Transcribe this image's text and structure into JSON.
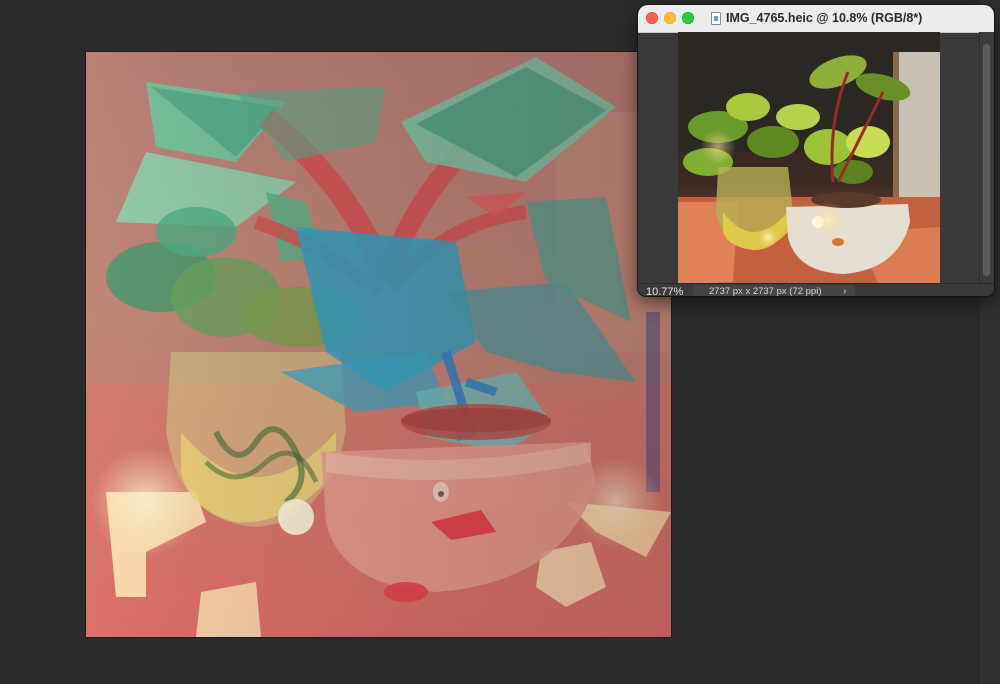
{
  "document": {
    "title": "IMG_4765.heic @ 10.8% (RGB/8*)",
    "zoom": "10.77%",
    "size_info": "2737 px x 2737 px (72 ppi)",
    "status_arrow": "›"
  },
  "icons": {
    "close": "close-traffic-light",
    "minimize": "minimize-traffic-light",
    "maximize": "maximize-traffic-light",
    "file": "image-file-icon",
    "status_menu": "chevron-right-icon"
  },
  "colors": {
    "workspace": "#2b2b2b",
    "titlebar": "#ececec",
    "close": "#fe5f57",
    "minimize": "#febc2e",
    "maximize": "#28c840"
  }
}
